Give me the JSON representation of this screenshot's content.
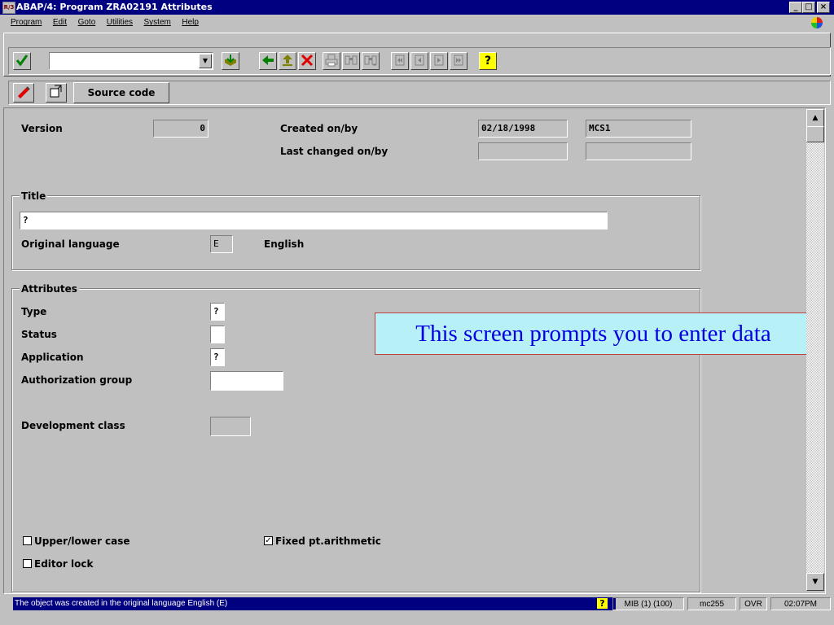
{
  "window": {
    "app_icon_text": "R/3",
    "title": "ABAP/4: Program ZRA02191 Attributes",
    "minimize": "_",
    "maximize": "□",
    "close": "×"
  },
  "menu": [
    "Program",
    "Edit",
    "Goto",
    "Utilities",
    "System",
    "Help"
  ],
  "toolbar": {
    "command_value": "",
    "icons": [
      "check-icon",
      "back-arrow-icon",
      "exit-icon",
      "cancel-icon",
      "print-icon",
      "find-icon",
      "find-next-icon",
      "first-page-icon",
      "prev-page-icon",
      "next-page-icon",
      "last-page-icon",
      "help-icon"
    ],
    "help_glyph": "?"
  },
  "app_toolbar": {
    "source_code_label": "Source code"
  },
  "header": {
    "version_label": "Version",
    "version_value": "0",
    "created_label": "Created on/by",
    "created_date": "02/18/1998",
    "created_by": "MCS1",
    "changed_label": "Last changed on/by",
    "changed_date": "",
    "changed_by": ""
  },
  "title_group": {
    "legend": "Title",
    "title_value": "?",
    "orig_lang_label": "Original language",
    "orig_lang_code": "E",
    "orig_lang_name": "English"
  },
  "attributes_group": {
    "legend": "Attributes",
    "type_label": "Type",
    "type_value": "?",
    "status_label": "Status",
    "status_value": "",
    "application_label": "Application",
    "application_value": "?",
    "auth_group_label": "Authorization group",
    "auth_group_value": "",
    "dev_class_label": "Development class",
    "dev_class_value": "",
    "upper_lower_label": "Upper/lower case",
    "upper_lower_checked": false,
    "fixed_pt_label": "Fixed pt.arithmetic",
    "fixed_pt_checked": true,
    "editor_lock_label": "Editor lock",
    "editor_lock_checked": false
  },
  "callout": "This screen prompts you to enter data",
  "statusbar": {
    "message": "The object was created in the original language English (E)",
    "help_glyph": "?",
    "system": "MIB (1) (100)",
    "server": "mc255",
    "mode": "OVR",
    "time": "02:07PM"
  },
  "colors": {
    "titlebar": "#000080",
    "callout_bg": "#b8f0f8",
    "callout_text": "#0000e0",
    "check_green": "#008000",
    "cancel_red": "#e00000"
  }
}
